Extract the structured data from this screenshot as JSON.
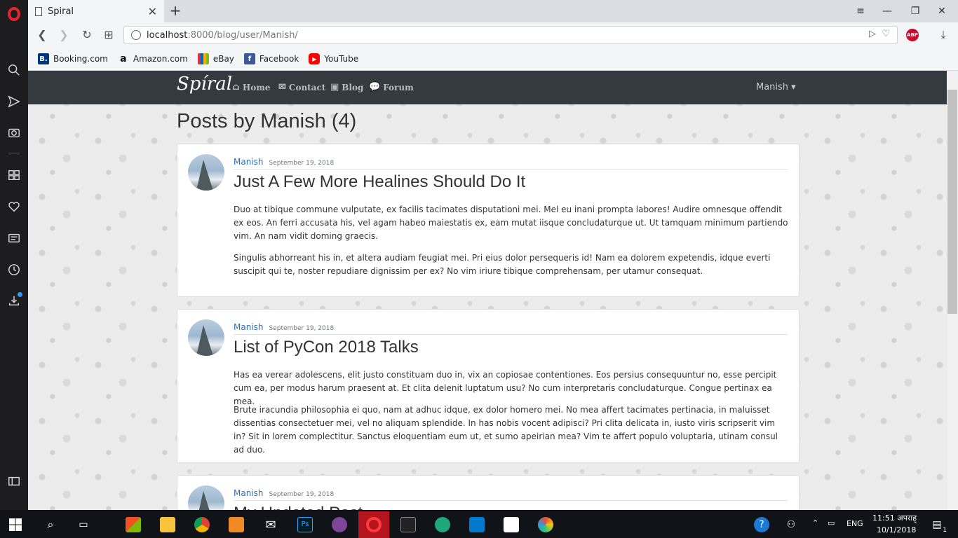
{
  "browser": {
    "tab_title": "Spiral",
    "url_host": "localhost",
    "url_rest": ":8000/blog/user/Manish/",
    "abp_label": "ABP",
    "bookmarks": [
      {
        "label": "Booking.com",
        "icon": "booking-icon",
        "color": "#003580",
        "glyph": "B."
      },
      {
        "label": "Amazon.com",
        "icon": "amazon-icon",
        "color": "#ffffff",
        "glyph": "a"
      },
      {
        "label": "eBay",
        "icon": "ebay-icon",
        "color": "#e53238",
        "glyph": ""
      },
      {
        "label": "Facebook",
        "icon": "facebook-icon",
        "color": "#3b5998",
        "glyph": "f"
      },
      {
        "label": "YouTube",
        "icon": "youtube-icon",
        "color": "#ff0000",
        "glyph": "▶"
      }
    ]
  },
  "site": {
    "brand": "Spíral",
    "nav": [
      {
        "label": "Home",
        "icon": "home-icon"
      },
      {
        "label": "Contact",
        "icon": "envelope-icon"
      },
      {
        "label": "Blog",
        "icon": "blog-icon"
      },
      {
        "label": "Forum",
        "icon": "comments-icon"
      }
    ],
    "user_menu": "Manish ▾"
  },
  "main": {
    "heading": "Posts by Manish (4)",
    "posts": [
      {
        "author": "Manish",
        "date": "September 19, 2018",
        "title": "Just A Few More Healines Should Do It",
        "paragraphs": [
          "Duo at tibique commune vulputate, ex facilis tacimates disputationi mei. Mel eu inani prompta labores! Audire omnesque offendit ex eos. An ferri accusata his, vel agam habeo maiestatis ex, eam mutat iisque concludaturque ut. Ut tamquam minimum partiendo vim. An nam vidit doming graecis.",
          "Singulis abhorreant his in, et altera audiam feugiat mei. Pri eius dolor persequeris id! Nam ea dolorem expetendis, idque everti suscipit qui te, noster repudiare dignissim per ex? No vim iriure tibique comprehensam, per utamur consequat."
        ]
      },
      {
        "author": "Manish",
        "date": "September 19, 2018",
        "title": "List of PyCon 2018 Talks",
        "paragraphs": [
          "Has ea verear adolescens, elit justo constituam duo in, vix an copiosae contentiones. Eos persius consequuntur no, esse percipit cum ea, per modus harum praesent at. Et clita delenit luptatum usu? No cum interpretaris concludaturque. Congue pertinax ea mea.",
          "Brute iracundia philosophia ei quo, nam at adhuc idque, ex dolor homero mei. No mea affert tacimates pertinacia, in maluisset dissentias consectetuer mei, vel no aliquam splendide. In has nobis vocent adipisci? Pri clita delicata in, iusto viris scripserit vim in? Sit in lorem complectitur. Sanctus eloquentiam eum ut, et sumo apeirian mea? Vim te affert populo voluptaria, utinam consul ad duo."
        ]
      },
      {
        "author": "Manish",
        "date": "September 19, 2018",
        "title": "My Updated Post",
        "paragraphs": []
      }
    ]
  },
  "taskbar": {
    "time": "11:51 अपराह्",
    "date": "10/1/2018",
    "lang": "ENG",
    "notif_count": "1"
  }
}
